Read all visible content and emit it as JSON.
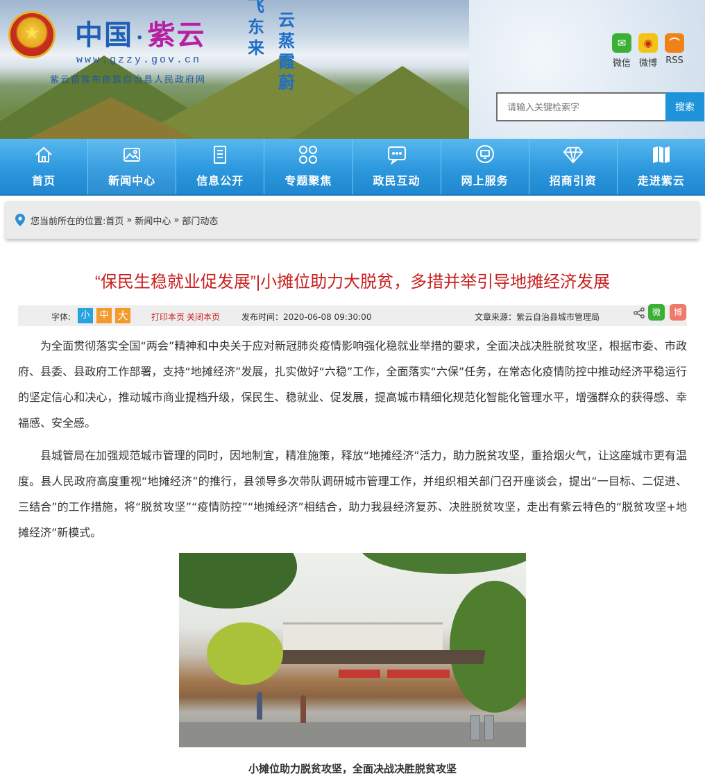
{
  "header": {
    "title_part1": "中国",
    "title_dot": "·",
    "title_part2": "紫云",
    "url": "www.gzzy.gov.cn",
    "subtitle": "紫云苗族布依族自治县人民政府网",
    "poem_col1": "飞东来",
    "poem_col2": "云蒸霞蔚"
  },
  "social": {
    "wechat": "微信",
    "weibo": "微博",
    "rss": "RSS"
  },
  "search": {
    "placeholder": "请输入关键检索字",
    "button": "搜索"
  },
  "nav": [
    {
      "label": "首页",
      "icon": "home-icon"
    },
    {
      "label": "新闻中心",
      "icon": "image-icon"
    },
    {
      "label": "信息公开",
      "icon": "document-icon"
    },
    {
      "label": "专题聚焦",
      "icon": "grid-circles-icon"
    },
    {
      "label": "政民互动",
      "icon": "chat-icon"
    },
    {
      "label": "网上服务",
      "icon": "monitor-icon"
    },
    {
      "label": "招商引资",
      "icon": "diamond-icon"
    },
    {
      "label": "走进紫云",
      "icon": "map-icon"
    }
  ],
  "breadcrumb": {
    "prefix": "您当前所在的位置: ",
    "items": [
      "首页",
      "新闻中心",
      "部门动态"
    ],
    "separator": "»"
  },
  "article": {
    "title": "“保民生稳就业促发展”|小摊位助力大脱贫，多措并举引导地摊经济发展",
    "font_label": "字体:",
    "font_small": "小",
    "font_medium": "中",
    "font_large": "大",
    "print": "打印本页",
    "close": "关闭本页",
    "date": "发布时间：2020-06-08 09:30:00",
    "source": "文章来源：紫云自治县城市管理局",
    "share_wechat": "微",
    "share_weibo": "博",
    "paragraph1": "为全面贯彻落实全国“两会”精神和中央关于应对新冠肺炎疫情影响强化稳就业举措的要求，全面决战决胜脱贫攻坚，根据市委、市政府、县委、县政府工作部署，支持“地摊经济”发展，扎实做好“六稳”工作，全面落实“六保”任务，在常态化疫情防控中推动经济平稳运行的坚定信心和决心，推动城市商业提档升级，保民生、稳就业、促发展，提高城市精细化规范化智能化管理水平，增强群众的获得感、幸福感、安全感。",
    "paragraph2": "县城管局在加强规范城市管理的同时，因地制宜，精准施策，释放“地摊经济”活力，助力脱贫攻坚，重拾烟火气，让这座城市更有温度。县人民政府高度重视“地摊经济”的推行，县领导多次带队调研城市管理工作，并组织相关部门召开座谈会，提出“一目标、二促进、三结合”的工作措施，将“脱贫攻坚”“疫情防控”“地摊经济”相结合，助力我县经济复苏、决胜脱贫攻坚，走出有紫云特色的“脱贫攻坚+地摊经济”新模式。",
    "caption": "小摊位助力脱贫攻坚，全面决战决胜脱贫攻坚"
  },
  "colors": {
    "accent": "#1e93d9",
    "title_red": "#c8201e",
    "nav_top": "#57b8ef",
    "nav_bottom": "#1f87cf"
  }
}
